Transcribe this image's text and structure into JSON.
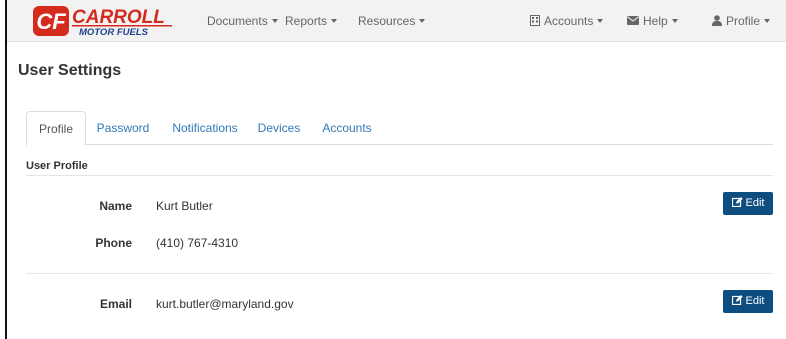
{
  "brand": {
    "logo_text_1": "CARROLL",
    "logo_text_2": "MOTOR FUELS",
    "colors": {
      "red": "#d52b1e",
      "blue": "#1f3f8f"
    }
  },
  "navbar": {
    "left_menus": [
      "Documents",
      "Reports",
      "Resources"
    ],
    "right_menus": [
      {
        "label": "Accounts",
        "icon": "building-icon"
      },
      {
        "label": "Help",
        "icon": "envelope-icon"
      },
      {
        "label": "Profile",
        "icon": "user-icon"
      }
    ]
  },
  "page": {
    "title": "User Settings"
  },
  "tabs": [
    {
      "label": "Profile",
      "active": true
    },
    {
      "label": "Password",
      "active": false
    },
    {
      "label": "Notifications",
      "active": false
    },
    {
      "label": "Devices",
      "active": false
    },
    {
      "label": "Accounts",
      "active": false
    }
  ],
  "profile": {
    "section_label": "User Profile",
    "name_label": "Name",
    "name_value": "Kurt Butler",
    "phone_label": "Phone",
    "phone_value": "(410) 767-4310",
    "email_label": "Email",
    "email_value": "kurt.butler@maryland.gov",
    "edit_label": "Edit"
  },
  "accent_color": "#0e4d7f",
  "link_color": "#337ab7"
}
